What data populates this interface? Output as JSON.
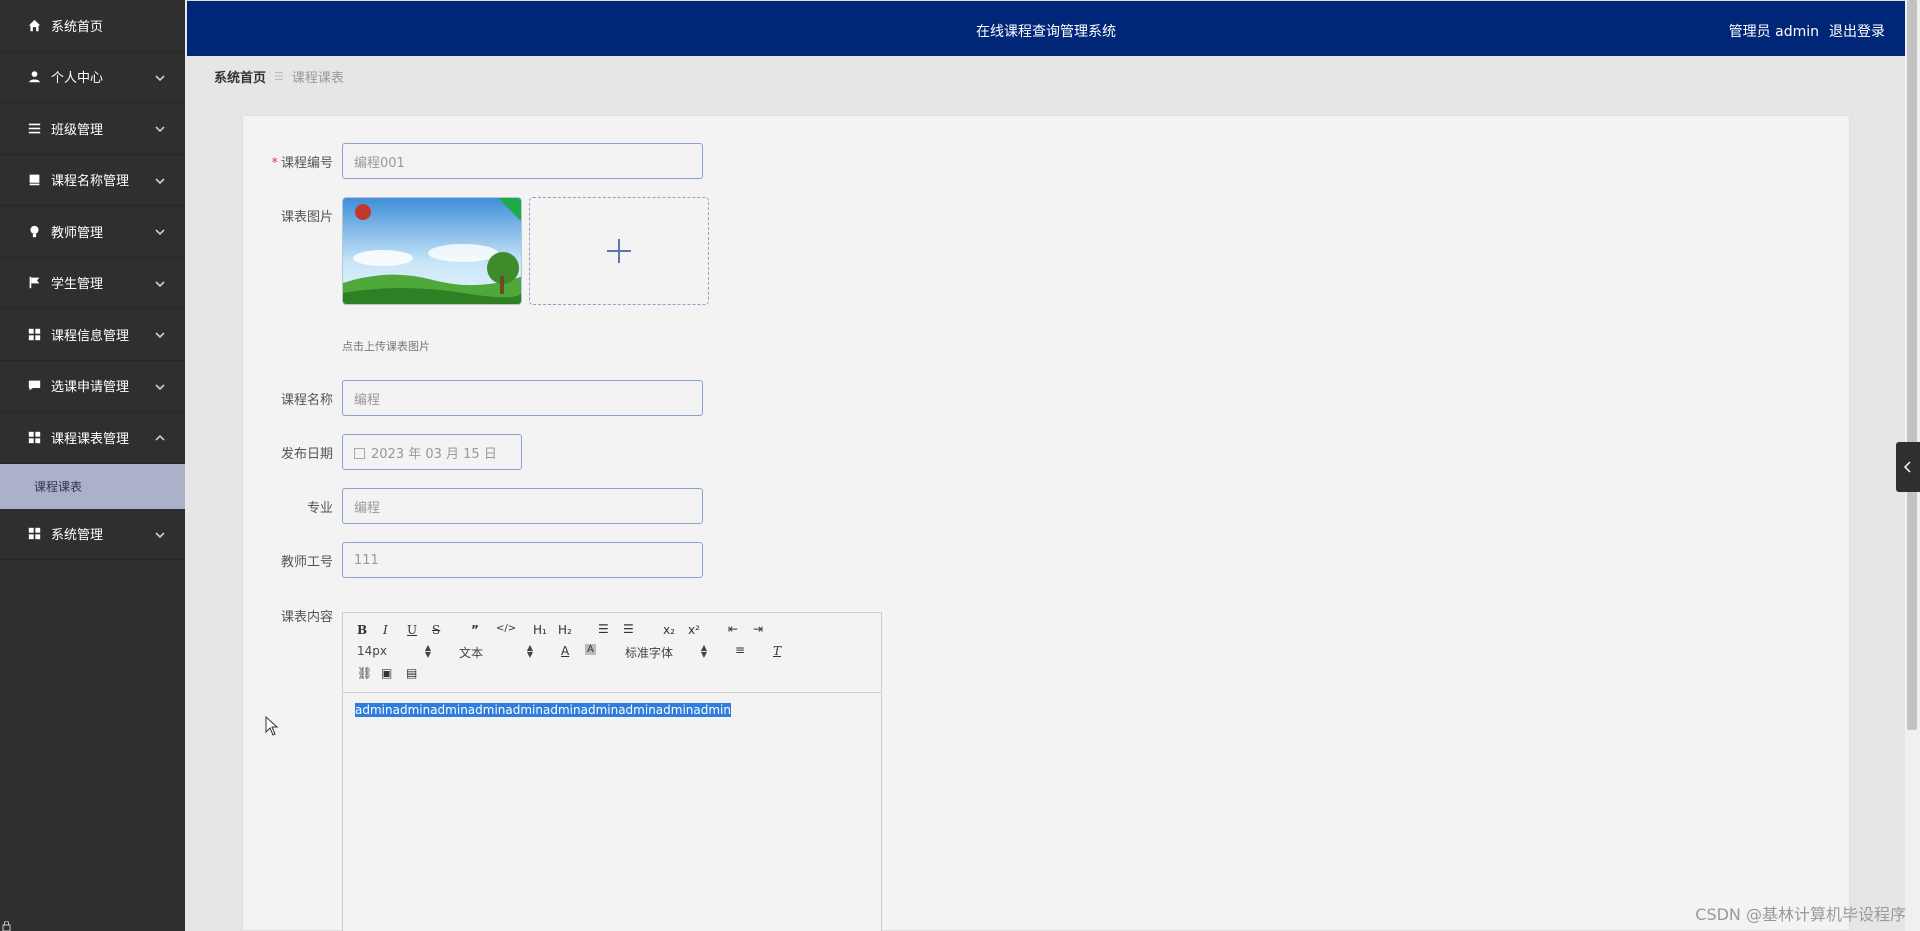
{
  "sidebar": {
    "items": [
      {
        "label": "系统首页",
        "icon": "home-icon",
        "has_arrow": false
      },
      {
        "label": "个人中心",
        "icon": "user-icon",
        "has_arrow": true
      },
      {
        "label": "班级管理",
        "icon": "list-icon",
        "has_arrow": true
      },
      {
        "label": "课程名称管理",
        "icon": "book-icon",
        "has_arrow": true
      },
      {
        "label": "教师管理",
        "icon": "lightbulb-icon",
        "has_arrow": true
      },
      {
        "label": "学生管理",
        "icon": "flag-icon",
        "has_arrow": true
      },
      {
        "label": "课程信息管理",
        "icon": "grid-icon",
        "has_arrow": true
      },
      {
        "label": "选课申请管理",
        "icon": "chat-icon",
        "has_arrow": true
      },
      {
        "label": "课程课表管理",
        "icon": "grid-icon",
        "has_arrow": true,
        "expanded": true
      },
      {
        "label": "系统管理",
        "icon": "grid-icon",
        "has_arrow": true
      }
    ],
    "sub_item": "课程课表"
  },
  "header": {
    "title": "在线课程查询管理系统",
    "user": "管理员 admin",
    "logout": "退出登录"
  },
  "breadcrumb": {
    "home": "系统首页",
    "current": "课程课表"
  },
  "form": {
    "course_no_label": "课程编号",
    "course_no_value": "编程001",
    "image_label": "课表图片",
    "image_tip": "点击上传课表图片",
    "course_name_label": "课程名称",
    "course_name_value": "编程",
    "publish_date_label": "发布日期",
    "publish_date_value": "2023 年 03 月 15 日",
    "major_label": "专业",
    "major_value": "编程",
    "teacher_no_label": "教师工号",
    "teacher_no_value": "111",
    "content_label": "课表内容"
  },
  "editor": {
    "font_size": "14px",
    "format": "文本",
    "font_family": "标准字体",
    "content": "adminadminadminadminadminadminadminadminadminadmin"
  },
  "watermark": "CSDN @基林计算机毕设程序",
  "colors": {
    "sidebar_bg": "#2f2f2f",
    "header_bg": "#002777",
    "active_sub_bg": "#aab1c9",
    "input_border": "#8aa3cc",
    "selection": "#2f7ddc"
  }
}
